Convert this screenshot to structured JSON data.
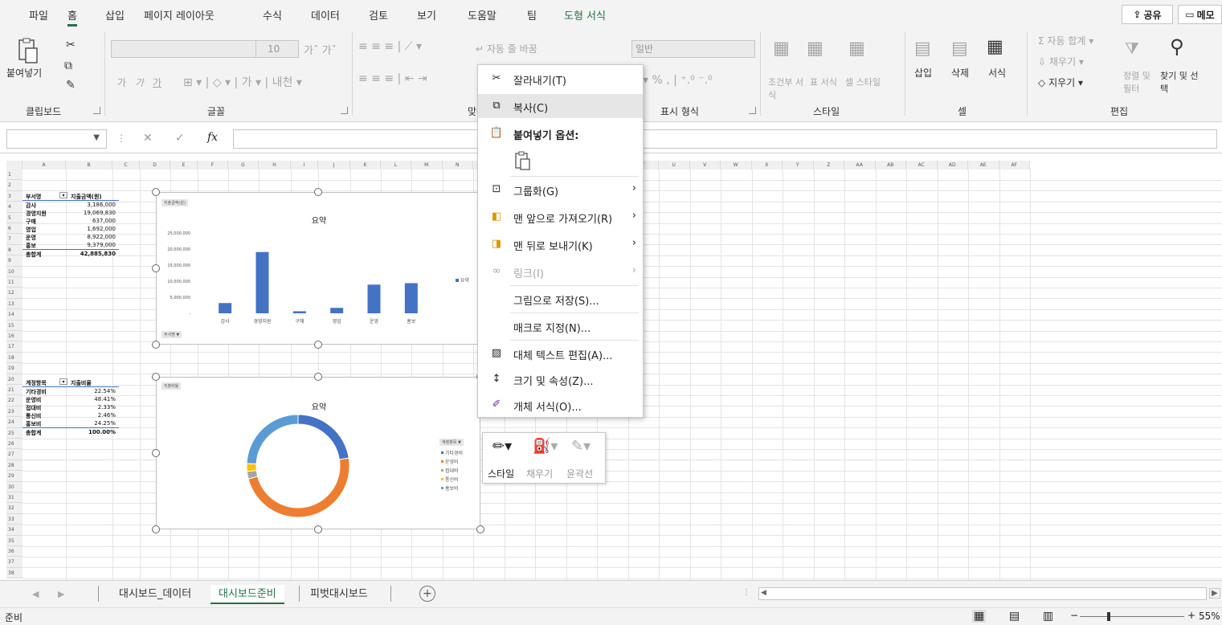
{
  "menu": {
    "tabs": [
      "파일",
      "홈",
      "삽입",
      "페이지 레이아웃",
      "수식",
      "데이터",
      "검토",
      "보기",
      "도움말",
      "팀",
      "도형 서식"
    ],
    "share_label": "공유",
    "memo_label": "메모"
  },
  "ribbon": {
    "clipboard": {
      "paste_label": "붙여넣기",
      "group_label": "클립보드"
    },
    "font": {
      "size": "10",
      "group_label": "글꼴",
      "bold": "가",
      "italic": "가",
      "underline": "가"
    },
    "alignment": {
      "wrap_text": "자동 줄 바꿈",
      "group_label": "맞춤"
    },
    "number": {
      "format": "일반",
      "group_label": "표시 형식"
    },
    "styles": {
      "conditional": "조건부 서식",
      "table": "표 서식",
      "cell": "셀 스타일",
      "group_label": "스타일"
    },
    "cells": {
      "insert": "삽입",
      "delete": "삭제",
      "format": "서식",
      "group_label": "셀"
    },
    "editing": {
      "autosum": "자동 합계",
      "fill": "채우기",
      "clear": "지우기",
      "sort_filter": "정렬 및 필터",
      "find_select": "찾기 및 선택",
      "group_label": "편집"
    }
  },
  "formula_bar": {
    "fx": "fx",
    "name": ""
  },
  "columns": [
    "A",
    "B",
    "C",
    "D",
    "E",
    "F",
    "G",
    "H",
    "I",
    "J",
    "K",
    "L",
    "M",
    "N",
    "O",
    "P",
    "Q",
    "R",
    "S",
    "T",
    "U",
    "V",
    "W",
    "X",
    "Y",
    "Z",
    "AA",
    "AB",
    "AC",
    "AD",
    "AE",
    "AF"
  ],
  "rows": [
    "1",
    "2",
    "3",
    "4",
    "5",
    "6",
    "7",
    "8",
    "9",
    "10",
    "11",
    "12",
    "13",
    "14",
    "15",
    "16",
    "17",
    "18",
    "19",
    "20",
    "21",
    "22",
    "23",
    "24",
    "25",
    "26",
    "27",
    "28",
    "29",
    "30",
    "31",
    "32",
    "33",
    "34",
    "35",
    "36",
    "37",
    "38"
  ],
  "table1": {
    "header": [
      "부서명",
      "지출금액(원)"
    ],
    "rows": [
      [
        "감사",
        "3,186,000"
      ],
      [
        "경영지원",
        "19,069,830"
      ],
      [
        "구매",
        "637,000"
      ],
      [
        "영업",
        "1,692,000"
      ],
      [
        "운영",
        "8,922,000"
      ],
      [
        "홍보",
        "9,379,000"
      ]
    ],
    "total": [
      "총합계",
      "42,885,830"
    ]
  },
  "table2": {
    "header": [
      "계정항목",
      "지출비율"
    ],
    "rows": [
      [
        "기타경비",
        "22.54%"
      ],
      [
        "운영비",
        "48.41%"
      ],
      [
        "접대비",
        "2.33%"
      ],
      [
        "통신비",
        "2.46%"
      ],
      [
        "홍보비",
        "24.25%"
      ]
    ],
    "total": [
      "총합계",
      "100.00%"
    ]
  },
  "chart_data": [
    {
      "type": "bar",
      "title": "요약",
      "field_button": "지출금액(원)",
      "axis_button": "부서명 ▼",
      "categories": [
        "감사",
        "경영지원",
        "구매",
        "영업",
        "운영",
        "홍보"
      ],
      "series": [
        {
          "name": "요약",
          "values": [
            3186000,
            19069830,
            637000,
            1692000,
            8922000,
            9379000
          ],
          "color": "#4472c4"
        }
      ],
      "y_ticks": [
        "25,000,000",
        "20,000,000",
        "15,000,000",
        "10,000,000",
        "5,000,000",
        "-"
      ],
      "ylim": [
        0,
        25000000
      ],
      "legend": "right"
    },
    {
      "type": "pie",
      "title": "요약",
      "field_button": "지출비율",
      "legend_button": "계정항목 ▼",
      "categories": [
        "기타경비",
        "운영비",
        "접대비",
        "통신비",
        "홍보비"
      ],
      "values": [
        22.54,
        48.41,
        2.33,
        2.46,
        24.25
      ],
      "colors": [
        "#4472c4",
        "#ed7d31",
        "#a5a5a5",
        "#ffc000",
        "#5b9bd5"
      ],
      "legend": "right"
    }
  ],
  "context_menu": {
    "cut": "잘라내기(T)",
    "copy": "복사(C)",
    "paste_options": "붙여넣기 옵션:",
    "group": "그룹화(G)",
    "bring_front": "맨 앞으로 가져오기(R)",
    "send_back": "맨 뒤로 보내기(K)",
    "link": "링크(I)",
    "save_picture": "그림으로 저장(S)...",
    "assign_macro": "매크로 지정(N)...",
    "alt_text": "대체 텍스트 편집(A)...",
    "size_props": "크기 및 속성(Z)...",
    "format_object": "개체 서식(O)..."
  },
  "mini_toolbar": {
    "style": "스타일",
    "fill": "채우기",
    "outline": "윤곽선"
  },
  "sheets": {
    "tabs": [
      "대시보드_데이터",
      "대시보드준비",
      "피벗대시보드"
    ],
    "active": "대시보드준비"
  },
  "status": {
    "ready": "준비",
    "zoom": "55%"
  },
  "colors": {
    "accent": "#217346",
    "bar": "#4472c4"
  }
}
